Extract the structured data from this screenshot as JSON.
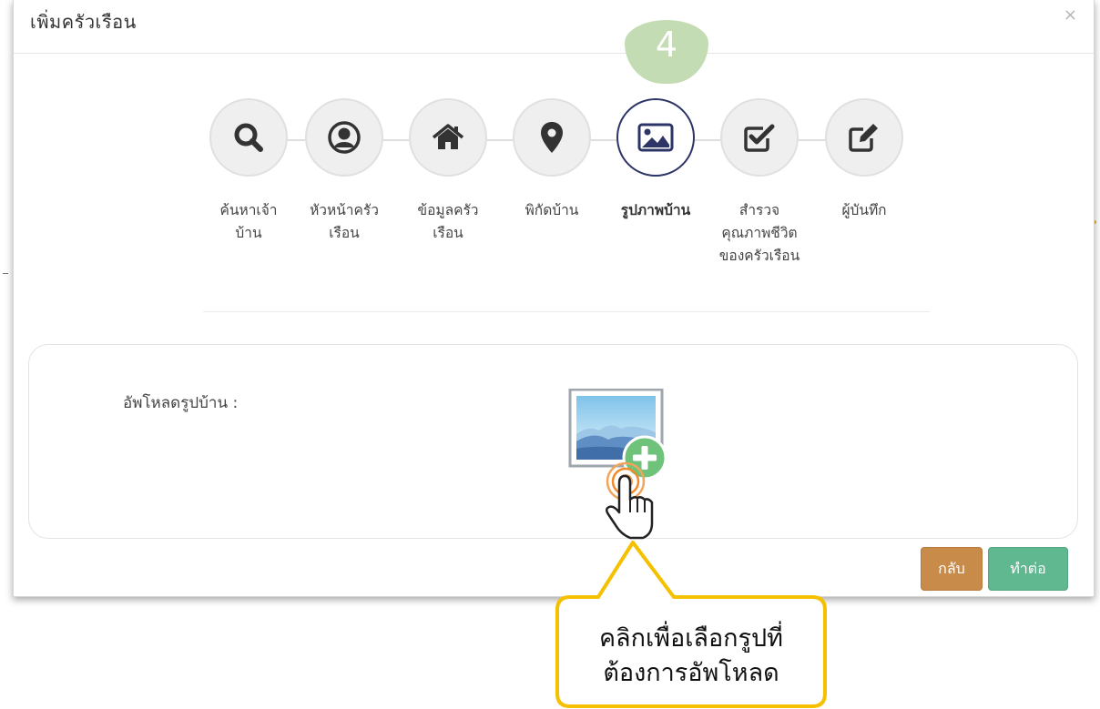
{
  "modal": {
    "title": "เพิ่มครัวเรือน",
    "close_symbol": "×"
  },
  "current_step_number": "4",
  "steps": [
    {
      "label": "ค้นหาเจ้าบ้าน",
      "icon": "search-icon",
      "active": false
    },
    {
      "label": "หัวหน้าครัวเรือน",
      "icon": "user-circle-icon",
      "active": false
    },
    {
      "label": "ข้อมูลครัวเรือน",
      "icon": "home-icon",
      "active": false
    },
    {
      "label": "พิกัดบ้าน",
      "icon": "map-marker-icon",
      "active": false
    },
    {
      "label": "รูปภาพบ้าน",
      "icon": "image-icon",
      "active": true
    },
    {
      "label": "สำรวจคุณภาพชีวิตของครัวเรือน",
      "icon": "check-square-icon",
      "active": false
    },
    {
      "label": "ผู้บันทึก",
      "icon": "edit-icon",
      "active": false
    }
  ],
  "upload": {
    "label": "อัพโหลดรูปบ้าน :",
    "icon": "add-image-icon"
  },
  "buttons": {
    "back": "กลับ",
    "next": "ทำต่อ"
  },
  "callout": {
    "line1": "คลิกเพื่อเลือกรูปที่",
    "line2": "ต้องการอัพโหลด"
  },
  "colors": {
    "active_step_border": "#2d3466",
    "step_badge": "#c4dcb3",
    "back_button": "#c98b4a",
    "next_button": "#5fb88f",
    "callout_border": "#f5c000"
  }
}
